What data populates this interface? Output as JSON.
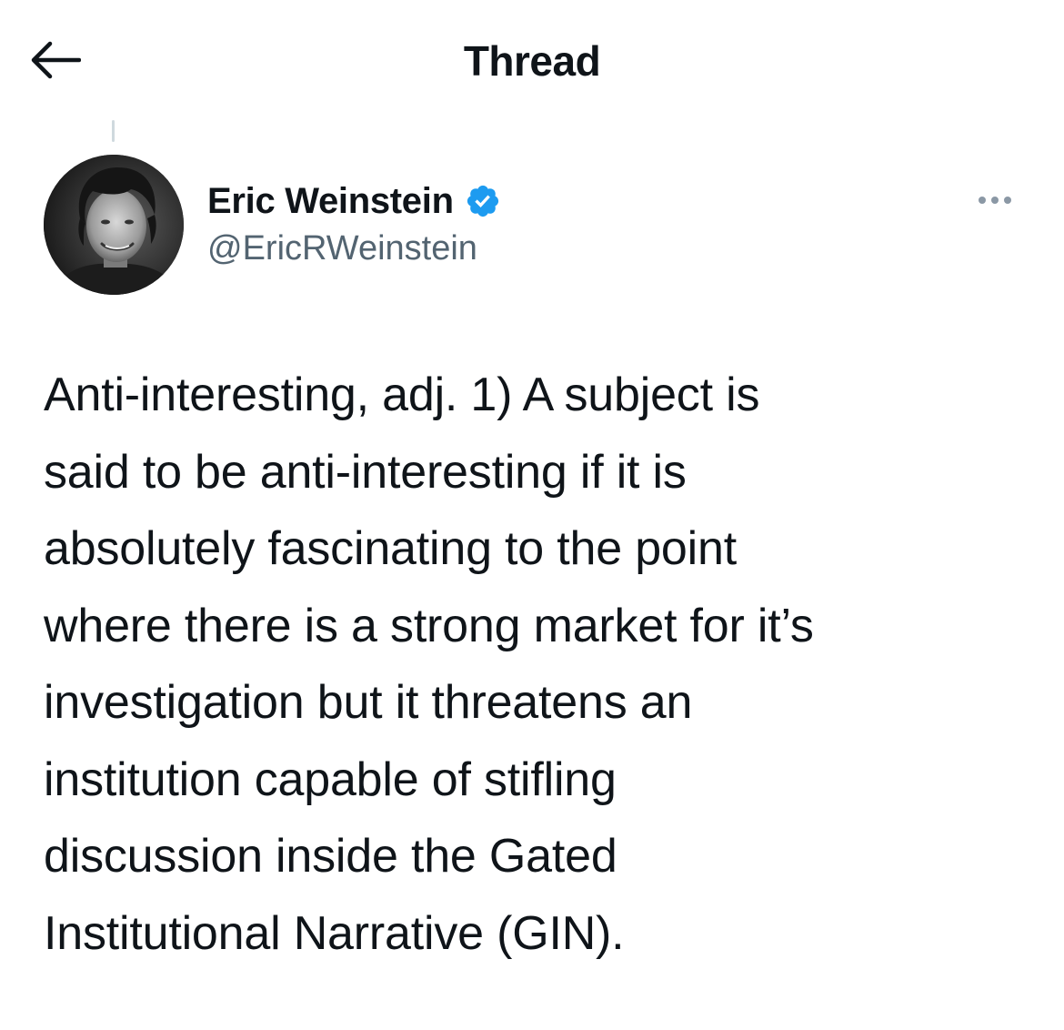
{
  "header": {
    "title": "Thread",
    "back_icon": "arrow-left-icon"
  },
  "tweet": {
    "author": {
      "display_name": "Eric Weinstein",
      "handle": "@EricRWeinstein",
      "verified": true,
      "verified_color": "#1d9bf0"
    },
    "more_icon": "more-horizontal-icon",
    "text_lines": [
      "Anti-interesting, adj. 1) A subject is",
      "said to be anti-interesting if it is",
      "absolutely fascinating to the point",
      "where there is a strong market for it’s",
      "investigation but it threatens an",
      "institution capable of stifling",
      "discussion inside the Gated",
      "Institutional Narrative (GIN)."
    ]
  },
  "colors": {
    "text_primary": "#0f1419",
    "text_secondary": "#536471",
    "thread_line": "#cfd9de",
    "background": "#ffffff"
  }
}
